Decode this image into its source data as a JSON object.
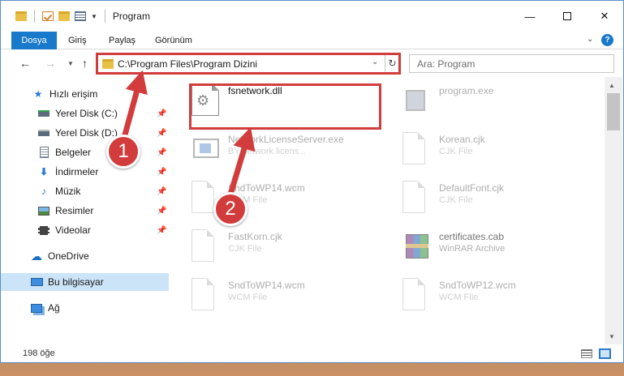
{
  "window": {
    "title": "Program",
    "controls": {
      "minimize": "—",
      "close": "✕"
    }
  },
  "ribbon": {
    "tabs": [
      "Dosya",
      "Giriş",
      "Paylaş",
      "Görünüm"
    ],
    "expand_icon": "chevron-down-icon",
    "help_label": "?"
  },
  "address": {
    "path": "C:\\Program Files\\Program Dizini",
    "search_placeholder": "Ara: Program"
  },
  "nav": {
    "quick_access": "Hızlı erişim",
    "items": [
      {
        "label": "Yerel Disk (C:)",
        "icon": "drive-icon",
        "pinned": true
      },
      {
        "label": "Yerel Disk (D:)",
        "icon": "drive-icon",
        "pinned": true
      },
      {
        "label": "Belgeler",
        "icon": "documents-icon",
        "pinned": true
      },
      {
        "label": "İndirmeler",
        "icon": "download-icon",
        "pinned": true
      },
      {
        "label": "Müzik",
        "icon": "music-icon",
        "pinned": true
      },
      {
        "label": "Resimler",
        "icon": "pictures-icon",
        "pinned": true
      },
      {
        "label": "Videolar",
        "icon": "videos-icon",
        "pinned": true
      }
    ],
    "onedrive": "OneDrive",
    "this_pc": "Bu bilgisayar",
    "network": "Ağ"
  },
  "files": [
    {
      "name": "fsnetwork.dll",
      "type": "",
      "icon": "dll-gear-icon",
      "highlighted": true
    },
    {
      "name": "program.exe",
      "type": "",
      "icon": "exe-icon"
    },
    {
      "name": "NetworkLicenseServer.exe",
      "type": "BY network licens...",
      "icon": "exe-icon"
    },
    {
      "name": "Korean.cjk",
      "type": "CJK File",
      "icon": "document-icon"
    },
    {
      "name": "SndToWP14.wcm",
      "type": "WCM File",
      "icon": "document-icon"
    },
    {
      "name": "DefaultFont.cjk",
      "type": "CJK File",
      "icon": "document-icon"
    },
    {
      "name": "FastKorn.cjk",
      "type": "CJK File",
      "icon": "document-icon"
    },
    {
      "name": "certificates.cab",
      "type": "WinRAR Archive",
      "icon": "winrar-icon"
    },
    {
      "name": "SndToWP14.wcm",
      "type": "WCM File",
      "icon": "document-icon"
    },
    {
      "name": "SndToWP12.wcm",
      "type": "WCM File",
      "icon": "document-icon"
    }
  ],
  "status": {
    "item_count": "198 öğe"
  },
  "annotations": {
    "callout_1": "1",
    "callout_2": "2",
    "highlight_color": "#d23c3c"
  },
  "colors": {
    "accent": "#1979ca",
    "selection": "#cce4f7"
  }
}
